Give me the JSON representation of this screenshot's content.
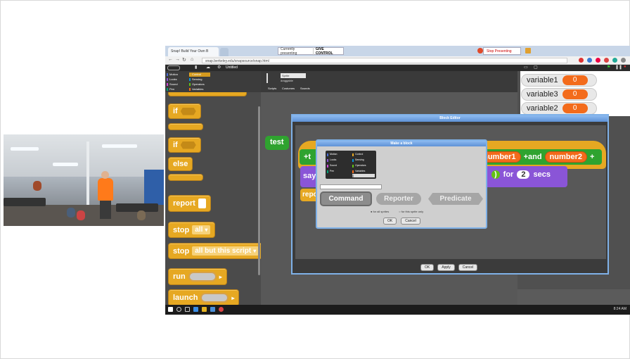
{
  "browser": {
    "tab_title": "Snap! Build Your Own B",
    "presenting_label": "Currently presenting",
    "give_control_label": "GIVE CONTROL",
    "stop_presenting_label": "Stop Presenting",
    "url": "snap.berkeley.edu/snapsource/snap.html"
  },
  "snap": {
    "project_title": "Untitled",
    "categories": [
      {
        "label": "Motion",
        "color": "#4a6cd4"
      },
      {
        "label": "Control",
        "color": "#e6a822"
      },
      {
        "label": "Looks",
        "color": "#8a55d7"
      },
      {
        "label": "Sensing",
        "color": "#0494dc"
      },
      {
        "label": "Sound",
        "color": "#cf4ad9"
      },
      {
        "label": "Operators",
        "color": "#62c213"
      },
      {
        "label": "Pen",
        "color": "#00a178"
      },
      {
        "label": "Variables",
        "color": "#f36b1b"
      }
    ],
    "palette": {
      "if_label": "if",
      "if_else_label": "if",
      "else_label": "else",
      "report_label": "report",
      "stop_label": "stop",
      "stop_all_value": "all",
      "stop2_label": "stop",
      "stop_script_value": "all but this script",
      "run_label": "run",
      "launch_label": "launch"
    },
    "sprite": {
      "name": "Sprite",
      "draggable_label": "draggable",
      "tabs": [
        "Scripts",
        "Costumes",
        "Sounds"
      ]
    },
    "script_block_label": "test",
    "variables": [
      {
        "name": "variable1",
        "value": "0"
      },
      {
        "name": "variable3",
        "value": "0"
      },
      {
        "name": "variable2",
        "value": "0"
      }
    ]
  },
  "block_editor": {
    "title": "Block Editor",
    "header_prefix": "+t",
    "param1": "number1",
    "and_label": "+and",
    "param2": "number2",
    "plus_label": "+",
    "say_label": "say",
    "say_secs_num": "2",
    "for_label": "for",
    "secs_label": "secs",
    "report_label": "repo",
    "buttons": [
      "OK",
      "Apply",
      "Cancel"
    ]
  },
  "make_block": {
    "title": "Make a block",
    "kinds": {
      "command": "Command",
      "reporter": "Reporter",
      "predicate": "Predicate"
    },
    "radio_all": "for all sprites",
    "radio_this": "for this sprite only",
    "ok_label": "OK",
    "cancel_label": "Cancel"
  },
  "taskbar": {
    "clock": "8:24 AM"
  }
}
